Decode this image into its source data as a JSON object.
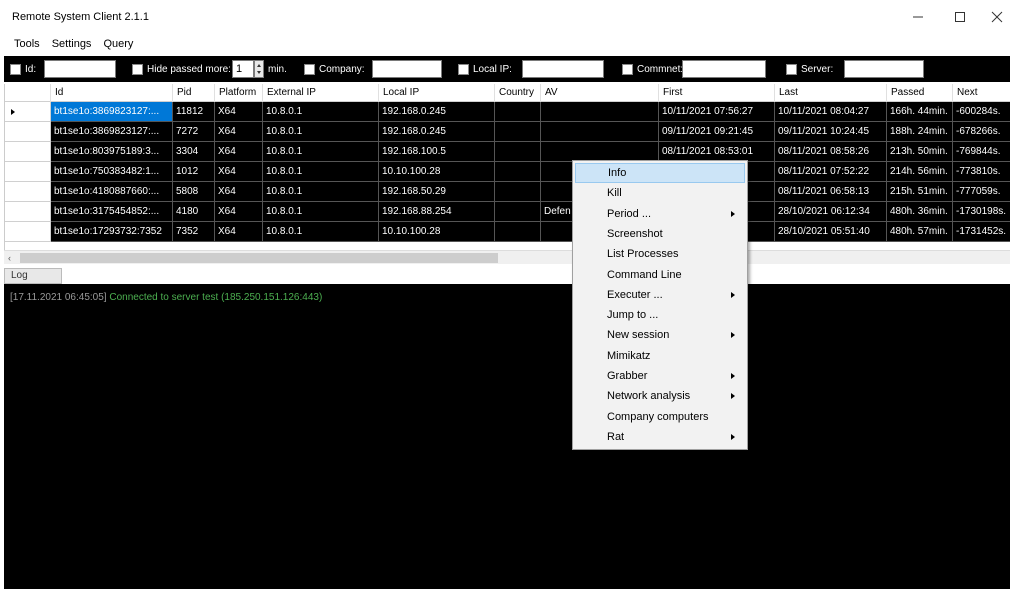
{
  "window": {
    "title": "Remote System Client 2.1.1"
  },
  "menubar": [
    "Tools",
    "Settings",
    "Query"
  ],
  "filters": {
    "id_label": "Id:",
    "hide_label": "Hide passed more:",
    "hide_value": "1",
    "min_label": "min.",
    "company_label": "Company:",
    "localip_label": "Local IP:",
    "comment_label": "Commnet:",
    "server_label": "Server:"
  },
  "grid": {
    "columns": [
      "Id",
      "Pid",
      "Platform",
      "External IP",
      "Local IP",
      "Country",
      "AV",
      "First",
      "Last",
      "Passed",
      "Next"
    ],
    "rows": [
      [
        "bt1se1o:3869823127:...",
        "11812",
        "X64",
        "10.8.0.1",
        "192.168.0.245",
        "",
        "",
        "10/11/2021 07:56:27",
        "10/11/2021 08:04:27",
        "166h. 44min.",
        "-600284s."
      ],
      [
        "bt1se1o:3869823127:...",
        "7272",
        "X64",
        "10.8.0.1",
        "192.168.0.245",
        "",
        "",
        "09/11/2021 09:21:45",
        "09/11/2021 10:24:45",
        "188h. 24min.",
        "-678266s."
      ],
      [
        "bt1se1o:803975189:3...",
        "3304",
        "X64",
        "10.8.0.1",
        "192.168.100.5",
        "",
        "",
        "08/11/2021 08:53:01",
        "08/11/2021 08:58:26",
        "213h. 50min.",
        "-769844s."
      ],
      [
        "bt1se1o:750383482:1...",
        "1012",
        "X64",
        "10.8.0.1",
        "10.10.100.28",
        "",
        "",
        "...07",
        "08/11/2021 07:52:22",
        "214h. 56min.",
        "-773810s."
      ],
      [
        "bt1se1o:4180887660:...",
        "5808",
        "X64",
        "10.8.0.1",
        "192.168.50.29",
        "",
        "",
        "...35",
        "08/11/2021 06:58:13",
        "215h. 51min.",
        "-777059s."
      ],
      [
        "bt1se1o:3175454852:...",
        "4180",
        "X64",
        "10.8.0.1",
        "192.168.88.254",
        "",
        "Defen",
        "...14",
        "28/10/2021 06:12:34",
        "480h. 36min.",
        "-1730198s."
      ],
      [
        "bt1se1o:17293732:7352",
        "7352",
        "X64",
        "10.8.0.1",
        "10.10.100.28",
        "",
        "",
        "...57",
        "28/10/2021 05:51:40",
        "480h. 57min.",
        "-1731452s."
      ]
    ]
  },
  "log": {
    "tab_label": "Log",
    "entries": [
      {
        "timestamp": "[17.11.2021 06:45:05]",
        "message": "Connected to server test (185.250.151.126:443)"
      }
    ]
  },
  "context_menu": [
    {
      "label": "Info",
      "submenu": false
    },
    {
      "label": "Kill",
      "submenu": false
    },
    {
      "label": "Period ...",
      "submenu": true
    },
    {
      "label": "Screenshot",
      "submenu": false
    },
    {
      "label": "List Processes",
      "submenu": false
    },
    {
      "label": "Command Line",
      "submenu": false
    },
    {
      "label": "Executer ...",
      "submenu": true
    },
    {
      "label": "Jump to ...",
      "submenu": false
    },
    {
      "label": "New session",
      "submenu": true
    },
    {
      "label": "Mimikatz",
      "submenu": false
    },
    {
      "label": "Grabber",
      "submenu": true
    },
    {
      "label": "Network analysis",
      "submenu": true
    },
    {
      "label": "Company computers",
      "submenu": false
    },
    {
      "label": "Rat",
      "submenu": true
    }
  ],
  "colors": {
    "grid_bg": "#000000",
    "selection": "#0078d7",
    "menu_highlight": "#cce4f7",
    "log_text": "#4caf50"
  }
}
